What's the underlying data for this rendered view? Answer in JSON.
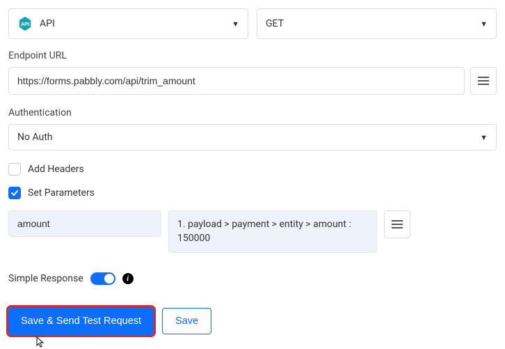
{
  "topRow": {
    "appSelect": {
      "label": "API"
    },
    "methodSelect": {
      "label": "GET"
    }
  },
  "endpoint": {
    "label": "Endpoint URL",
    "value": "https://forms.pabbly.com/api/trim_amount"
  },
  "auth": {
    "label": "Authentication",
    "value": "No Auth"
  },
  "headers": {
    "label": "Add Headers",
    "checked": false
  },
  "params": {
    "label": "Set Parameters",
    "checked": true,
    "rows": [
      {
        "key": "amount",
        "value": "1. payload > payment > entity > amount : 150000"
      }
    ]
  },
  "simpleResponse": {
    "label": "Simple Response",
    "on": true
  },
  "buttons": {
    "primary": "Save & Send Test Request",
    "secondary": "Save"
  }
}
